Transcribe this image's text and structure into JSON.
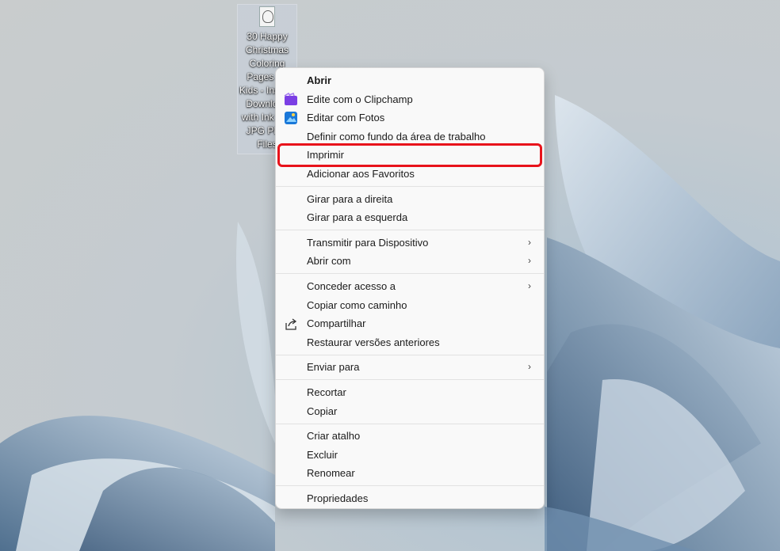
{
  "desktop": {
    "file_label": "30 Happy Christmas Coloring Pages for Kids - Instant Download with Ink 270 JPG PNG Files"
  },
  "menu": {
    "groups": [
      [
        {
          "label": "Abrir",
          "icon": "",
          "bold": true,
          "sub": false
        },
        {
          "label": "Edite com o Clipchamp",
          "icon": "clipchamp-icon",
          "bold": false,
          "sub": false
        },
        {
          "label": "Editar com Fotos",
          "icon": "photos-icon",
          "bold": false,
          "sub": false
        },
        {
          "label": "Definir como fundo da área de trabalho",
          "icon": "",
          "bold": false,
          "sub": false
        },
        {
          "label": "Imprimir",
          "icon": "",
          "bold": false,
          "sub": false
        },
        {
          "label": "Adicionar aos Favoritos",
          "icon": "",
          "bold": false,
          "sub": false
        }
      ],
      [
        {
          "label": "Girar para a direita",
          "icon": "",
          "bold": false,
          "sub": false
        },
        {
          "label": "Girar para a esquerda",
          "icon": "",
          "bold": false,
          "sub": false
        }
      ],
      [
        {
          "label": "Transmitir para Dispositivo",
          "icon": "",
          "bold": false,
          "sub": true
        },
        {
          "label": "Abrir com",
          "icon": "",
          "bold": false,
          "sub": true
        }
      ],
      [
        {
          "label": "Conceder acesso a",
          "icon": "",
          "bold": false,
          "sub": true
        },
        {
          "label": "Copiar como caminho",
          "icon": "",
          "bold": false,
          "sub": false
        },
        {
          "label": "Compartilhar",
          "icon": "share-icon",
          "bold": false,
          "sub": false
        },
        {
          "label": "Restaurar versões anteriores",
          "icon": "",
          "bold": false,
          "sub": false
        }
      ],
      [
        {
          "label": "Enviar para",
          "icon": "",
          "bold": false,
          "sub": true
        }
      ],
      [
        {
          "label": "Recortar",
          "icon": "",
          "bold": false,
          "sub": false
        },
        {
          "label": "Copiar",
          "icon": "",
          "bold": false,
          "sub": false
        }
      ],
      [
        {
          "label": "Criar atalho",
          "icon": "",
          "bold": false,
          "sub": false
        },
        {
          "label": "Excluir",
          "icon": "",
          "bold": false,
          "sub": false
        },
        {
          "label": "Renomear",
          "icon": "",
          "bold": false,
          "sub": false
        }
      ],
      [
        {
          "label": "Propriedades",
          "icon": "",
          "bold": false,
          "sub": false
        }
      ]
    ],
    "submenu_glyph": "›",
    "highlighted_item": "Imprimir",
    "highlight_color": "#e8131b"
  }
}
